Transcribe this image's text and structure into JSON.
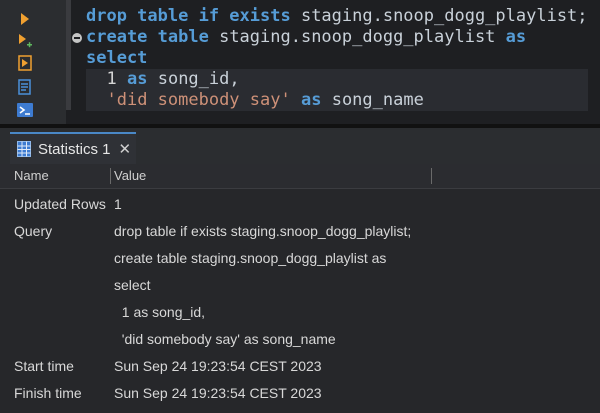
{
  "editor": {
    "line1": {
      "kw1": "drop table if exists",
      "ident": "staging.snoop_dogg_playlist;"
    },
    "line2": {
      "kw1": "create table",
      "ident": "staging.snoop_dogg_playlist",
      "kw2": "as"
    },
    "line3": {
      "kw1": "select"
    },
    "line4": {
      "num": "1",
      "kw": "as",
      "ident": "song_id,"
    },
    "line5": {
      "str": "'did somebody say'",
      "kw": "as",
      "ident": "song_name"
    }
  },
  "results": {
    "tab_label": "Statistics 1",
    "close_glyph": "✕",
    "columns": {
      "name": "Name",
      "value": "Value"
    },
    "rows": [
      {
        "name": "Updated Rows",
        "value": "1"
      },
      {
        "name": "Query",
        "value": "drop table if exists staging.snoop_dogg_playlist;"
      },
      {
        "name": "",
        "value": "create table staging.snoop_dogg_playlist as"
      },
      {
        "name": "",
        "value": "select"
      },
      {
        "name": "",
        "value": "  1 as song_id,"
      },
      {
        "name": "",
        "value": "  'did somebody say' as song_name"
      },
      {
        "name": "Start time",
        "value": "Sun Sep 24 19:23:54 CEST 2023"
      },
      {
        "name": "Finish time",
        "value": "Sun Sep 24 19:23:54 CEST 2023"
      }
    ]
  },
  "icons": {
    "gutter": [
      "execute-statement-icon",
      "execute-statement-new-tab-icon",
      "execute-script-icon",
      "explain-plan-icon",
      "console-icon"
    ],
    "tab": "grid-icon"
  },
  "colors": {
    "keyword": "#569cd6",
    "string": "#ce9178",
    "accent": "#f0a030",
    "tab_accent": "#4a88c7"
  }
}
